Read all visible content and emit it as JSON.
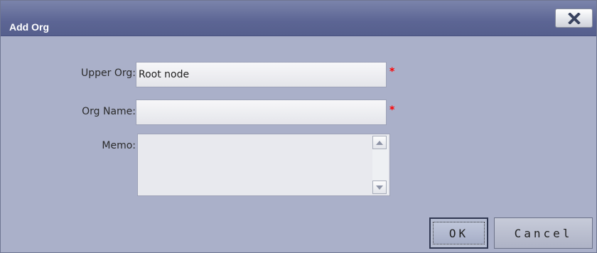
{
  "dialog": {
    "title": "Add Org",
    "close_icon": "close-x-icon"
  },
  "form": {
    "upper_org": {
      "label": "Upper Org:",
      "value": "Root node",
      "required_mark": "*"
    },
    "org_name": {
      "label": "Org Name:",
      "value": "",
      "required_mark": "*"
    },
    "memo": {
      "label": "Memo:",
      "value": ""
    }
  },
  "buttons": {
    "ok_label": "OK",
    "cancel_label": "Cancel"
  },
  "colors": {
    "titlebar": "#5c6594",
    "dialog_bg": "#aab0c9",
    "required": "#ff0000"
  }
}
